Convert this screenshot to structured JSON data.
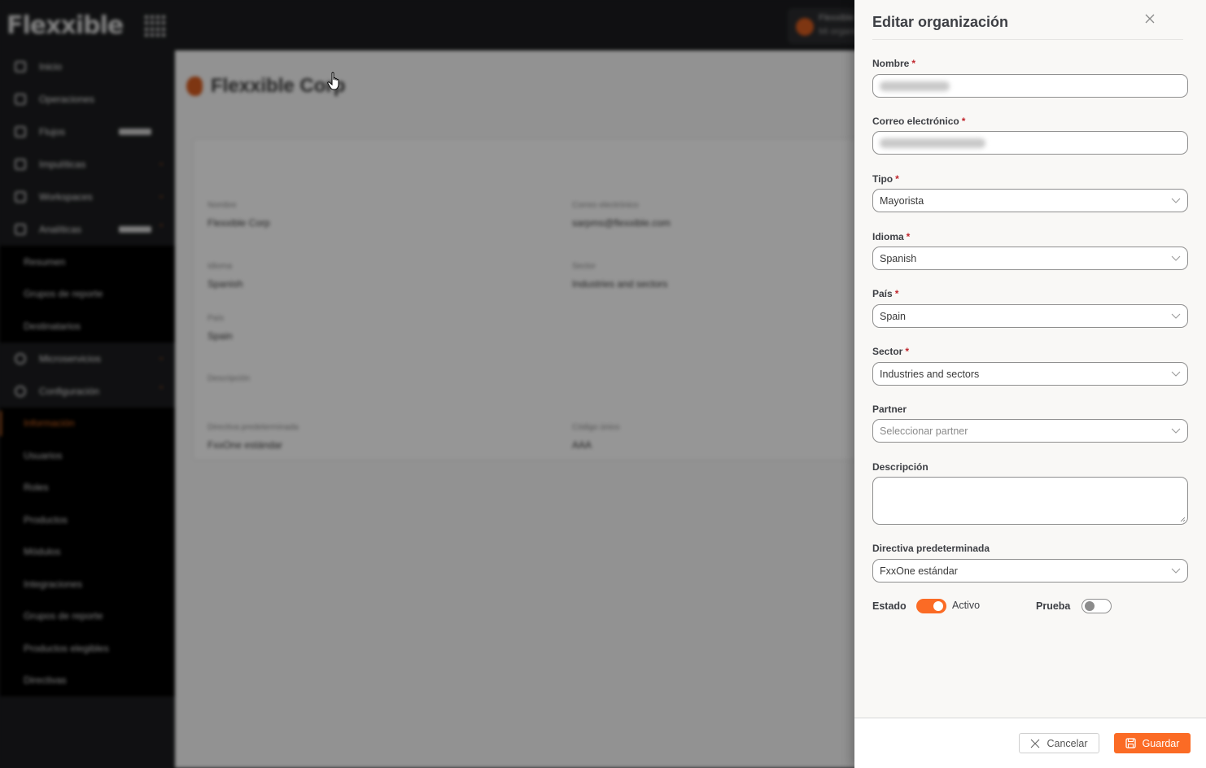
{
  "app": {
    "logo_text": "Flexxible",
    "org_switcher": {
      "line1": "Flexxible",
      "line2": "Mi organización"
    }
  },
  "sidebar": {
    "items": [
      {
        "label": "Inicio",
        "icon": "home-icon"
      },
      {
        "label": "Operaciones",
        "icon": "operations-icon"
      },
      {
        "label": "Flujos",
        "icon": "flows-icon",
        "badge": true
      },
      {
        "label": "Impulíticas",
        "icon": "analytics-icon",
        "chevron": "down"
      },
      {
        "label": "Workspaces",
        "icon": "workspaces-icon",
        "chevron": "down"
      },
      {
        "label": "Analíticas",
        "icon": "reports-icon",
        "badge": true,
        "chevron": "up"
      }
    ],
    "analytics_sub": [
      "Resumen",
      "Grupos de reporte",
      "Destinatarios"
    ],
    "items2": [
      {
        "label": "Microservicios",
        "icon": "microservices-icon",
        "chevron": "down"
      },
      {
        "label": "Configuración",
        "icon": "settings-icon",
        "chevron": "up"
      }
    ],
    "settings_sub": [
      {
        "label": "Información",
        "active": true
      },
      {
        "label": "Usuarios"
      },
      {
        "label": "Roles"
      },
      {
        "label": "Productos"
      },
      {
        "label": "Módulos"
      },
      {
        "label": "Integraciones"
      },
      {
        "label": "Grupos de reporte"
      },
      {
        "label": "Productos elegibles"
      },
      {
        "label": "Directivas"
      }
    ]
  },
  "page": {
    "title": "Flexxible Corp",
    "fields": {
      "name_label": "Nombre",
      "name_value": "Flexxible Corp",
      "email_label": "Correo electrónico",
      "email_value": "sarpms@flexxible.com",
      "language_label": "Idioma",
      "language_value": "Spanish",
      "sector_label": "Sector",
      "sector_value": "Industries and sectors",
      "country_label": "País",
      "country_value": "Spain",
      "description_label": "Descripción",
      "directive_label": "Directiva predeterminada",
      "directive_value": "FxxOne estándar",
      "code_label": "Código único",
      "code_value": "AAA"
    }
  },
  "drawer": {
    "title": "Editar organización",
    "required_mark": "*",
    "fields": {
      "name": {
        "label": "Nombre",
        "required": true,
        "value": ""
      },
      "email": {
        "label": "Correo electrónico",
        "required": true,
        "value": ""
      },
      "type": {
        "label": "Tipo",
        "required": true,
        "value": "Mayorista"
      },
      "language": {
        "label": "Idioma",
        "required": true,
        "value": "Spanish"
      },
      "country": {
        "label": "País",
        "required": true,
        "value": "Spain"
      },
      "sector": {
        "label": "Sector",
        "required": true,
        "value": "Industries and sectors"
      },
      "partner": {
        "label": "Partner",
        "required": false,
        "placeholder": "Seleccionar partner"
      },
      "description": {
        "label": "Descripción",
        "value": ""
      },
      "directive": {
        "label": "Directiva predeterminada",
        "value": "FxxOne estándar"
      }
    },
    "status": {
      "label": "Estado",
      "on": true,
      "text": "Activo"
    },
    "trial": {
      "label": "Prueba",
      "on": false
    },
    "buttons": {
      "cancel": "Cancelar",
      "save": "Guardar"
    }
  },
  "colors": {
    "accent": "#fb6b25",
    "required": "#c0262d",
    "sidebar_bg": "#1b1c1e",
    "drawer_bg": "#f9f8f6"
  }
}
